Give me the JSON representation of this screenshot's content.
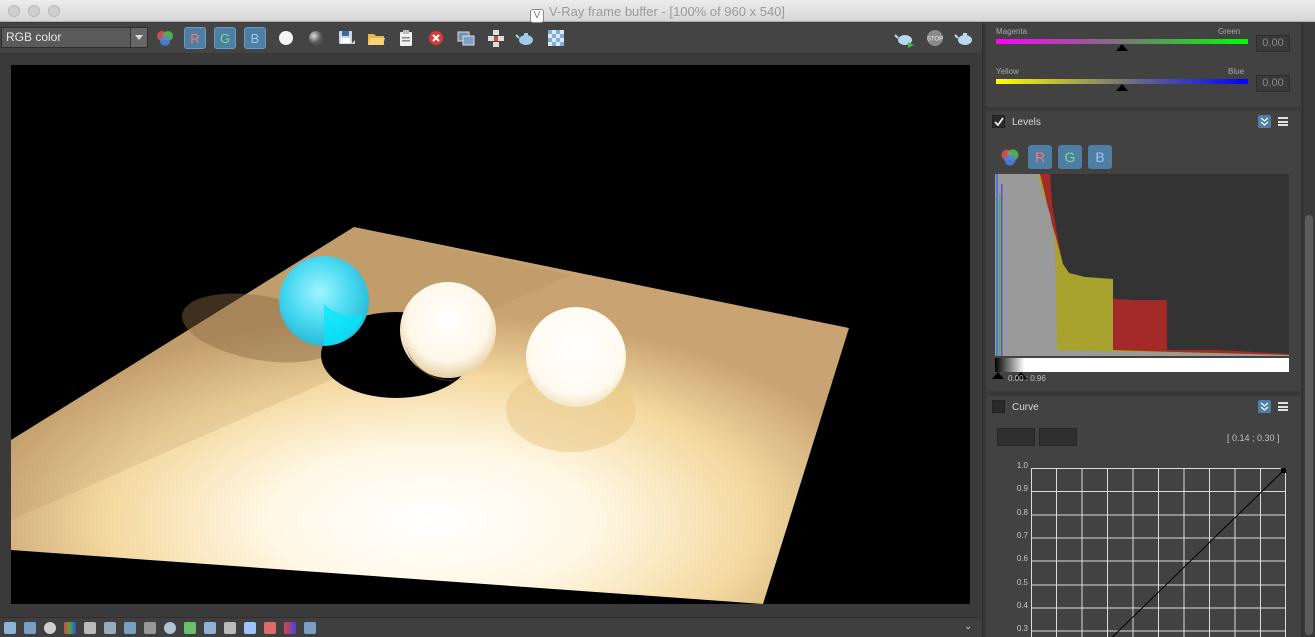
{
  "window": {
    "title": "V-Ray frame buffer - [100% of 960 x 540]",
    "logo_glyph": "V"
  },
  "toolbar": {
    "channel_select": "RGB color",
    "channel_buttons": {
      "r": "R",
      "g": "G",
      "b": "B"
    },
    "icons": [
      "rgb-channels-icon",
      "red-channel-button",
      "green-channel-button",
      "blue-channel-button",
      "white-sphere-icon",
      "grey-sphere-icon",
      "save-icon",
      "open-folder-icon",
      "clipboard-icon",
      "clear-icon",
      "compare-icon",
      "region-icon",
      "teapot-render-icon",
      "checker-icon",
      "render-teapot-icon",
      "stop-icon",
      "interactive-teapot-icon"
    ],
    "stop_label": "STOP"
  },
  "panel": {
    "color_balance": {
      "magenta_label": "Magenta",
      "green_label": "Green",
      "mg_value": "0.00",
      "mg_position": 0.5,
      "yellow_label": "Yellow",
      "blue_label": "Blue",
      "yb_value": "0.00",
      "yb_position": 0.5
    },
    "levels": {
      "title": "Levels",
      "enabled": true,
      "buttons": {
        "r": "R",
        "g": "G",
        "b": "B"
      },
      "range_label": "0.00 : 0.96"
    },
    "curve": {
      "title": "Curve",
      "enabled": false,
      "coords": "[ 0.14 ; 0.30 ]",
      "y_ticks": [
        "1.0",
        "0.9",
        "0.8",
        "0.7",
        "0.6",
        "0.5",
        "0.4",
        "0.3"
      ]
    }
  },
  "colors": {
    "accent": "#4f7ea5",
    "red_text": "#ff7a6e",
    "green_text": "#7fdc8a",
    "blue_text": "#9ec3ff",
    "magenta": "#ff00ff",
    "green": "#00ff00",
    "yellow": "#ffff00",
    "blue": "#0000ff",
    "hist_red": "#a42a2a",
    "hist_yellow": "#a8a32e",
    "hist_grey": "#9a9a9a"
  }
}
